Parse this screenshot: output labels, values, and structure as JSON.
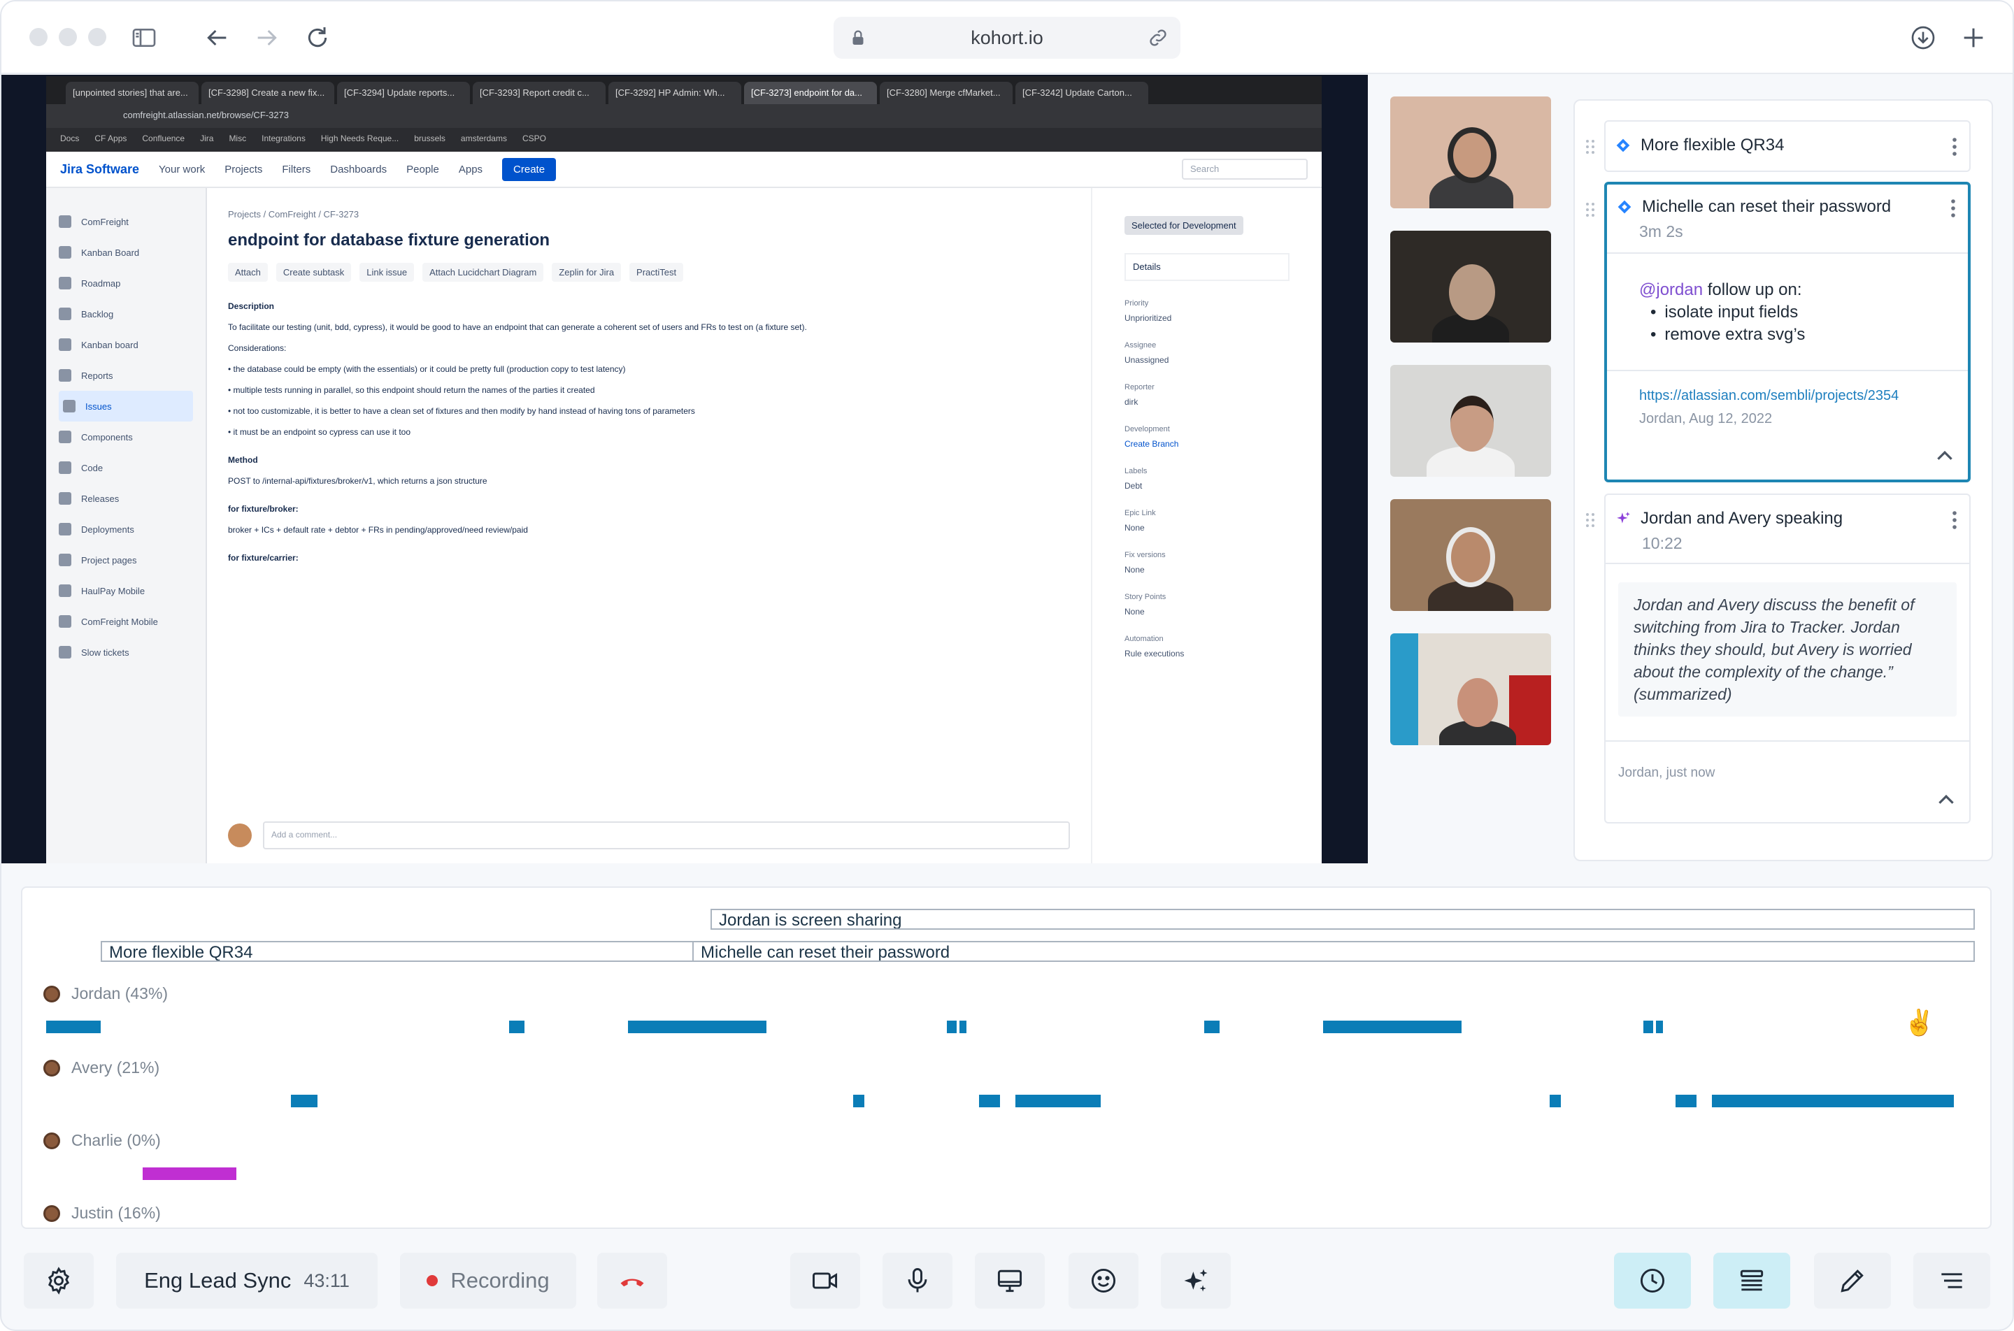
{
  "browser": {
    "url": "kohort.io"
  },
  "shared_screen": {
    "tabs": [
      "[unpointed stories] that are...",
      "[CF-3298] Create a new fix...",
      "[CF-3294] Update reports...",
      "[CF-3293] Report credit c...",
      "[CF-3292] HP Admin: Wh...",
      "[CF-3273] endpoint for da...",
      "[CF-3280] Merge cfMarket...",
      "[CF-3242] Update Carton..."
    ],
    "address": "comfreight.atlassian.net/browse/CF-3273",
    "bookmarks": [
      "Docs",
      "CF Apps",
      "Confluence",
      "Jira",
      "Misc",
      "Integrations",
      "High Needs Reque...",
      "brussels",
      "amsterdams",
      "CSPO"
    ],
    "nav": {
      "logo": "Jira Software",
      "items": [
        "Your work",
        "Projects",
        "Filters",
        "Dashboards",
        "People",
        "Apps"
      ],
      "create": "Create",
      "search": "Search"
    },
    "sidebar": {
      "project": "ComFreight",
      "items": [
        "Kanban Board",
        "Roadmap",
        "Backlog",
        "Kanban board",
        "Reports",
        "Issues",
        "Components",
        "Code",
        "Releases",
        "Deployments",
        "Project pages",
        "HaulPay Mobile",
        "ComFreight Mobile",
        "Slow tickets"
      ]
    },
    "issue": {
      "breadcrumb": "Projects / ComFreight / CF-3273",
      "title": "endpoint for database fixture generation",
      "actions": [
        "Attach",
        "Create subtask",
        "Link issue",
        "Attach Lucidchart Diagram",
        "Zeplin for Jira",
        "PractiTest"
      ],
      "description_label": "Description",
      "description": "To facilitate our testing (unit, bdd, cypress), it would be good to have an endpoint that can generate a coherent set of users and FRs to test on (a fixture set).",
      "considerations_label": "Considerations:",
      "considerations": [
        "the database could be empty (with the essentials) or it could be pretty full (production copy to test latency)",
        "multiple tests running in parallel, so this endpoint should return the names of the parties it created",
        "not too customizable, it is better to have a clean set of fixtures and then modify by hand instead of having tons of parameters",
        "it must be an endpoint so cypress can use it too"
      ],
      "method_label": "Method",
      "method": "POST to /internal-api/fixtures/broker/v1, which returns a json structure",
      "broker_label": "for fixture/broker:",
      "broker": "broker + ICs + default rate + debtor + FRs in pending/approved/need review/paid",
      "carrier_label": "for fixture/carrier:",
      "comment_placeholder": "Add a comment...",
      "status": "Selected for Development",
      "details_label": "Details",
      "fields": [
        {
          "label": "Priority",
          "value": "Unprioritized"
        },
        {
          "label": "Assignee",
          "value": "Unassigned"
        },
        {
          "label": "Reporter",
          "value": "dirk"
        },
        {
          "label": "Development",
          "value": "Create Branch"
        },
        {
          "label": "Labels",
          "value": "Debt"
        },
        {
          "label": "Epic Link",
          "value": "None"
        },
        {
          "label": "Fix versions",
          "value": "None"
        },
        {
          "label": "Story Points",
          "value": "None"
        },
        {
          "label": "Automation",
          "value": "Rule executions"
        }
      ]
    }
  },
  "notes": {
    "card1": {
      "title": "More flexible QR34"
    },
    "card2": {
      "title": "Michelle can reset their password",
      "duration": "3m 2s",
      "mention": "@jordan",
      "note_text": " follow up on:",
      "bullets": [
        "isolate input fields",
        "remove extra svg’s"
      ],
      "link": "https://atlassian.com/sembli/projects/2354",
      "meta": "Jordan, Aug 12, 2022"
    },
    "card3": {
      "title": "Jordan and Avery speaking",
      "time": "10:22",
      "summary": "Jordan and Avery discuss the benefit of switching from Jira to Tracker. Jordan thinks they should, but Avery is worried about the complexity of the change.” (summarized)",
      "meta": "Jordan, just now"
    }
  },
  "timeline": {
    "screen_share": "Jordan is screen sharing",
    "segments": [
      "More flexible QR34",
      "Michelle can reset their password"
    ],
    "people": [
      {
        "name": "Jordan (43%)"
      },
      {
        "name": "Avery (21%)"
      },
      {
        "name": "Charlie (0%)"
      },
      {
        "name": "Justin (16%)"
      }
    ],
    "reaction": "✌️"
  },
  "toolbar": {
    "meeting_name": "Eng Lead Sync",
    "elapsed": "43:11",
    "recording": "Recording"
  }
}
